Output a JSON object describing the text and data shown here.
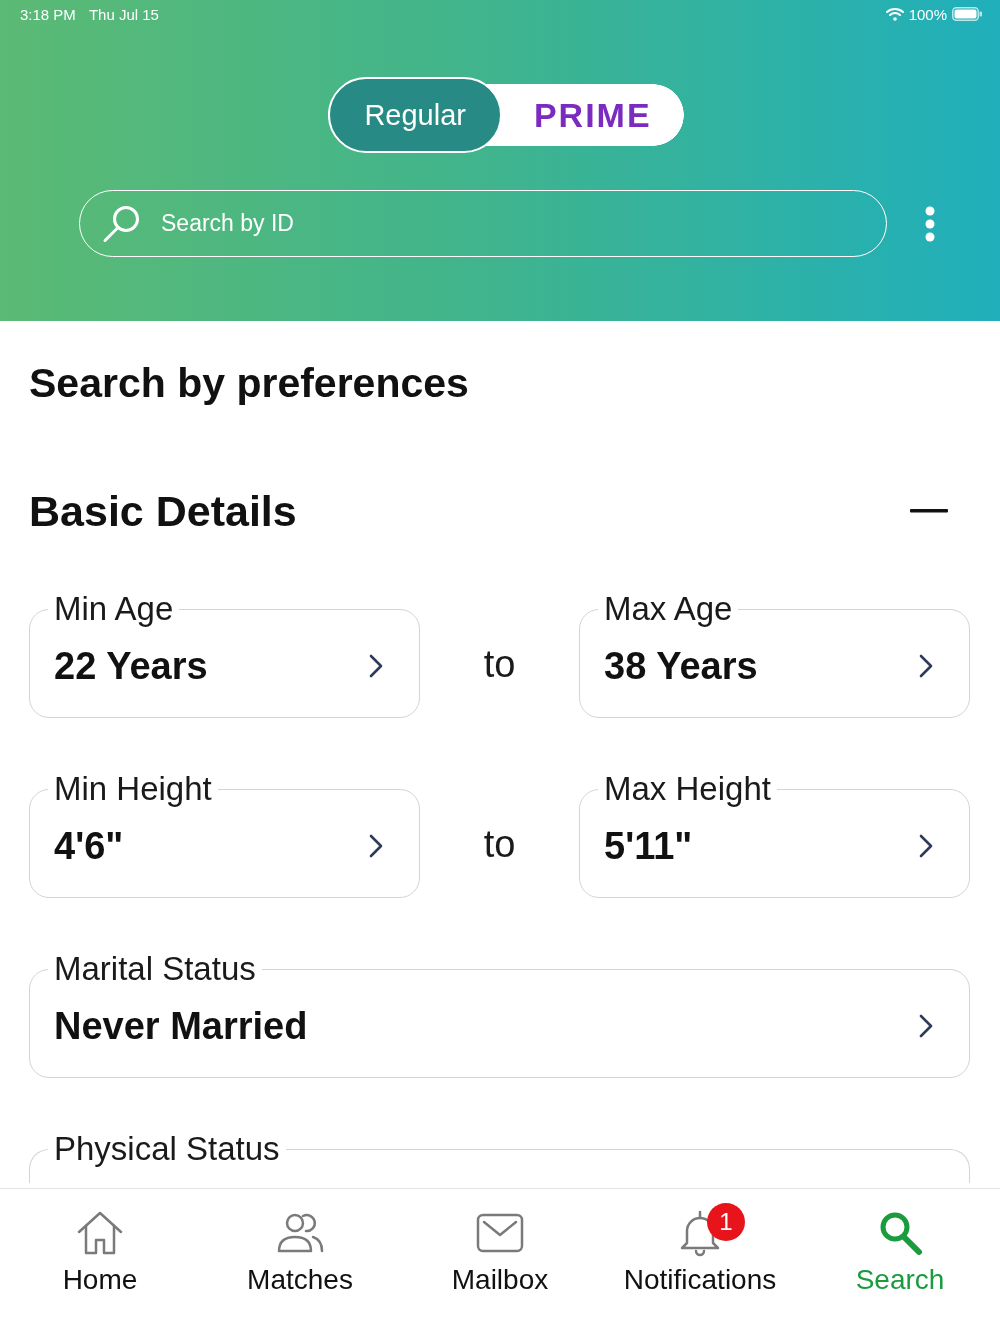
{
  "status_bar": {
    "time": "3:18 PM",
    "date": "Thu Jul 15",
    "battery": "100%"
  },
  "plan_toggle": [
    {
      "label": "Regular",
      "selected": true
    },
    {
      "label": "PRIME",
      "selected": false
    }
  ],
  "search": {
    "placeholder": "Search by ID"
  },
  "page_title": "Search by preferences",
  "section": {
    "title": "Basic Details",
    "expanded": true,
    "rows": [
      {
        "kind": "range",
        "from": {
          "label": "Min Age",
          "value": "22 Years"
        },
        "joiner": "to",
        "to": {
          "label": "Max Age",
          "value": "38 Years"
        }
      },
      {
        "kind": "range",
        "from": {
          "label": "Min Height",
          "value": "4'6\""
        },
        "joiner": "to",
        "to": {
          "label": "Max Height",
          "value": "5'11\""
        }
      },
      {
        "kind": "single",
        "field": {
          "label": "Marital Status",
          "value": "Never Married"
        }
      },
      {
        "kind": "single",
        "field": {
          "label": "Physical Status"
        }
      }
    ]
  },
  "tab_bar": [
    {
      "kind": "home",
      "label": "Home",
      "selected": false
    },
    {
      "kind": "people",
      "label": "Matches",
      "selected": false
    },
    {
      "kind": "mail",
      "label": "Mailbox",
      "selected": false
    },
    {
      "kind": "bell",
      "label": "Notifications",
      "selected": false,
      "badge": "1"
    },
    {
      "kind": "search",
      "label": "Search",
      "selected": true
    }
  ]
}
